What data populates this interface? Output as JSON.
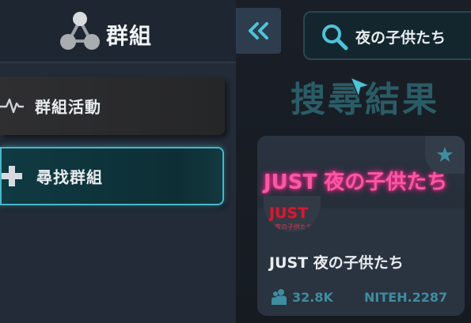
{
  "sidebar": {
    "title": "群組",
    "logo_icon": "groups-network-icon",
    "items": [
      {
        "label": "群組活動",
        "icon": "activity-pulse-icon"
      },
      {
        "label": "尋找群組",
        "icon": "plus-icon",
        "active": true
      }
    ]
  },
  "toolbar": {
    "collapse_icon": "double-chevron-left-icon"
  },
  "search": {
    "value": "夜の子供たち",
    "icon": "search-icon"
  },
  "results": {
    "heading": "搜尋結果",
    "cards": [
      {
        "banner_text": "JUST 夜の子供たち",
        "avatar_title": "JUST",
        "avatar_subtitle": "夜の子供たち",
        "name": "JUST 夜の子供たち",
        "members": "32.8K",
        "group_id": "NITEH.2287",
        "favorite_icon": "star-icon"
      }
    ]
  },
  "colors": {
    "accent": "#48b6c9",
    "sidebar_bg": "#222b37",
    "main_bg": "#181d25",
    "card_bg": "#2a3340",
    "neon_pink": "#f55aa4",
    "muted_teal": "#3e8da0"
  }
}
